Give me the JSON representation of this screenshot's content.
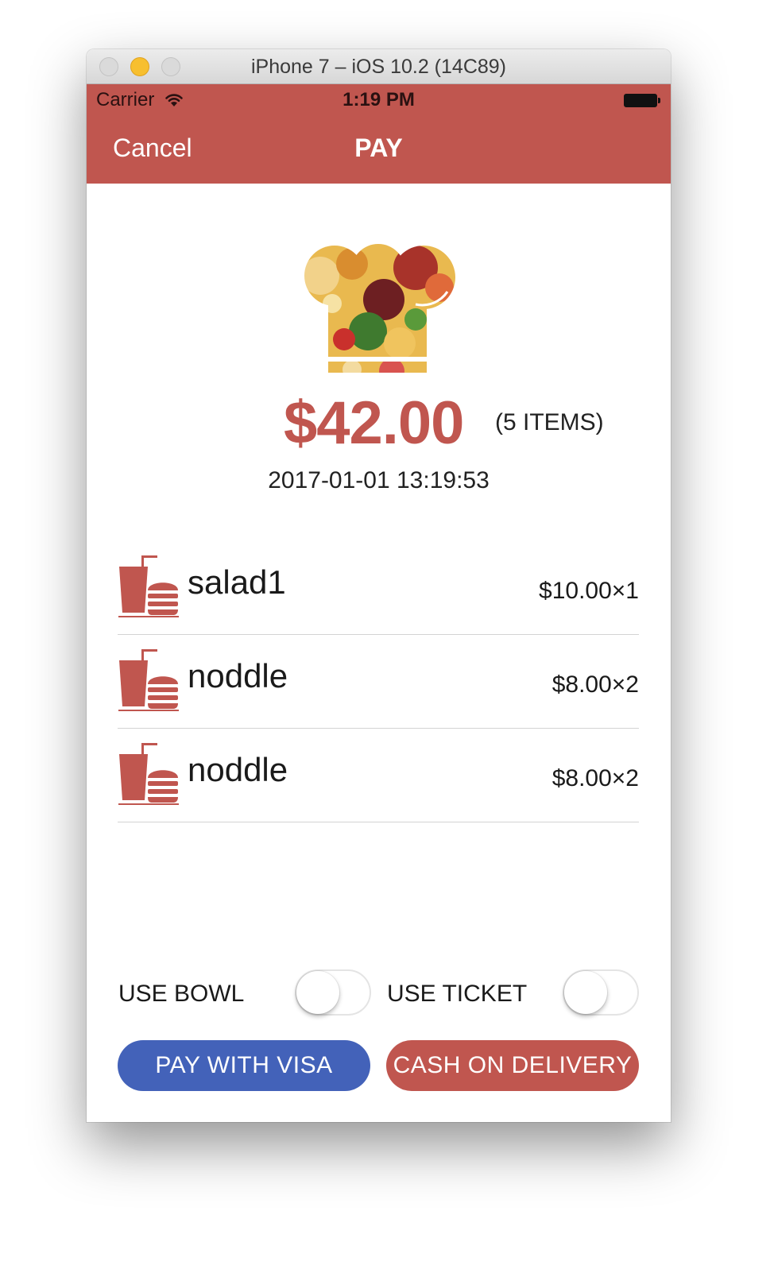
{
  "window": {
    "title": "iPhone 7 – iOS 10.2 (14C89)"
  },
  "status_bar": {
    "carrier": "Carrier",
    "time": "1:19 PM"
  },
  "nav": {
    "cancel_label": "Cancel",
    "title": "PAY"
  },
  "summary": {
    "total": "$42.00",
    "items_count": "(5 ITEMS)",
    "timestamp": "2017-01-01 13:19:53"
  },
  "items": [
    {
      "name": "salad1",
      "price": "$10.00×1",
      "icon": "food-drink-icon"
    },
    {
      "name": "noddle",
      "price": "$8.00×2",
      "icon": "food-drink-icon"
    },
    {
      "name": "noddle",
      "price": "$8.00×2",
      "icon": "food-drink-icon"
    }
  ],
  "options": {
    "use_bowl_label": "USE BOWL",
    "use_bowl_on": false,
    "use_ticket_label": "USE TICKET",
    "use_ticket_on": false
  },
  "actions": {
    "visa_label": "PAY WITH VISA",
    "cod_label": "CASH ON DELIVERY"
  },
  "colors": {
    "accent": "#c0564f",
    "visa": "#4362b9"
  }
}
